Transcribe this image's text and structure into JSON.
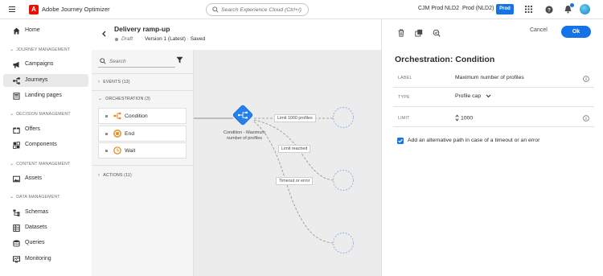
{
  "topbar": {
    "brand_letter": "A",
    "app_name": "Adobe Journey Optimizer",
    "search_placeholder": "Search Experience Cloud (Ctrl+/)",
    "org": "CJM Prod NLD2",
    "sandbox": "Prod (NLD2)",
    "env_badge": "Prod",
    "accent_color": "#1473e6"
  },
  "leftnav": {
    "home": "Home",
    "sections": {
      "journey_management": "JOURNEY MANAGEMENT",
      "decision_management": "DECISION MANAGEMENT",
      "content_management": "CONTENT MANAGEMENT",
      "data_management": "DATA MANAGEMENT"
    },
    "items": {
      "campaigns": "Campaigns",
      "journeys": "Journeys",
      "landing_pages": "Landing pages",
      "offers": "Offers",
      "components": "Components",
      "assets": "Assets",
      "schemas": "Schemas",
      "datasets": "Datasets",
      "queries": "Queries",
      "monitoring": "Monitoring"
    },
    "active_item": "Journeys"
  },
  "journey": {
    "title": "Delivery ramp-up",
    "status": "Draft",
    "version": "Version 1 (Latest) · Saved"
  },
  "palette": {
    "search_placeholder": "Search",
    "groups": {
      "events": "EVENTS (13)",
      "orchestration": "ORCHESTRATION (3)",
      "actions": "ACTIONS (11)"
    },
    "orchestration_items": [
      "Condition",
      "End",
      "Wait"
    ]
  },
  "canvas": {
    "condition_label": "Condition - Maximum number of profiles",
    "edges": [
      "Limit 1000 profiles",
      "Limit reached",
      "Timeout or error"
    ]
  },
  "panel": {
    "cancel": "Cancel",
    "ok": "Ok",
    "title": "Orchestration: Condition",
    "fields": {
      "label_key": "LABEL",
      "label_value": "Maximum number of profiles",
      "type_key": "TYPE",
      "type_value": "Profile cap",
      "limit_key": "LIMIT",
      "limit_value": "1000"
    },
    "alt_path_label": "Add an alternative path in case of a timeout or an error",
    "alt_path_checked": true
  }
}
